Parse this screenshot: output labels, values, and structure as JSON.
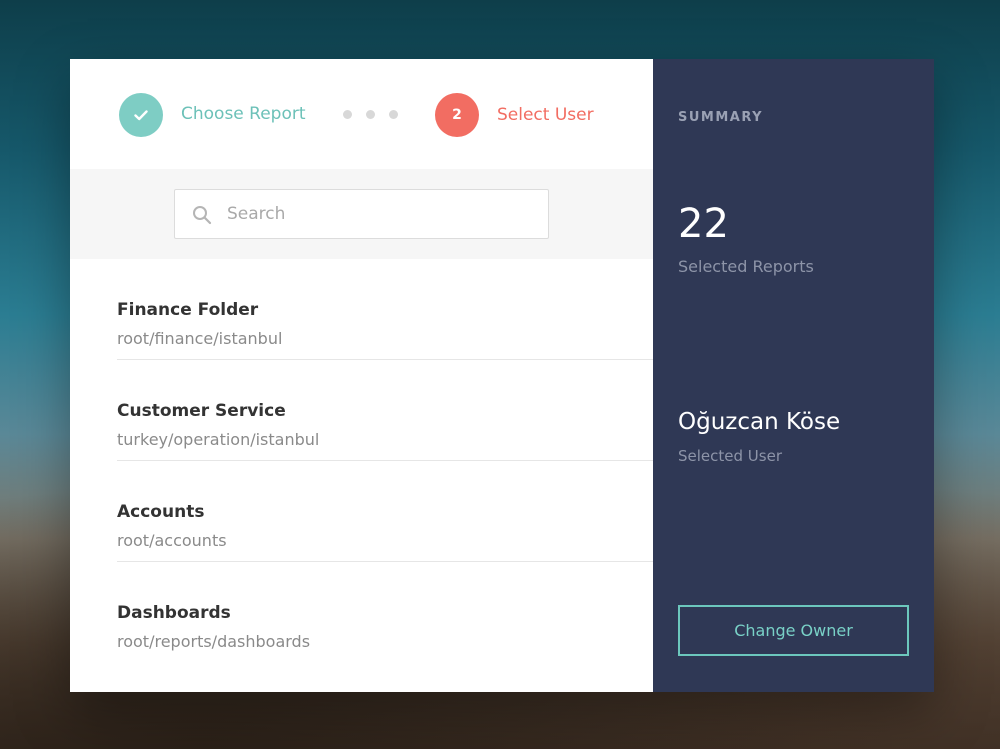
{
  "stepper": {
    "step1": {
      "label": "Choose Report",
      "icon": "checkmark-icon",
      "color": "#7ecdc4"
    },
    "step2": {
      "number": "2",
      "label": "Select User",
      "color": "#f26d62"
    }
  },
  "search": {
    "placeholder": "Search",
    "value": "",
    "icon": "search-icon"
  },
  "list": {
    "items": [
      {
        "title": "Finance Folder",
        "path": "root/finance/istanbul"
      },
      {
        "title": "Customer Service",
        "path": "turkey/operation/istanbul"
      },
      {
        "title": "Accounts",
        "path": "root/accounts"
      },
      {
        "title": "Dashboards",
        "path": "root/reports/dashboards"
      }
    ]
  },
  "summary": {
    "heading": "SUMMARY",
    "reports_count": "22",
    "reports_caption": "Selected Reports",
    "user_name": "Oğuzcan Köse",
    "user_caption": "Selected User",
    "button_label": "Change Owner",
    "accent_color": "#6cc7bd",
    "panel_color": "#2f3855"
  }
}
